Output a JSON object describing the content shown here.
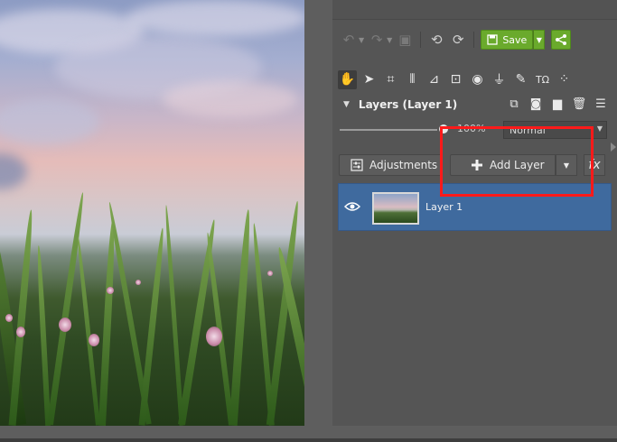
{
  "canvas": {
    "image_subject": "sunset sky over meadow grass with clover flowers"
  },
  "toolbar": {
    "undo_icon": "undo-icon",
    "redo_icon": "redo-icon",
    "history_icon": "history-icon",
    "rotate_left_icon": "rotate-left-icon",
    "rotate_right_icon": "rotate-right-icon",
    "save_label": "Save",
    "share_icon": "share-icon"
  },
  "tools": [
    {
      "name": "hand-tool-icon",
      "glyph": "✋",
      "active": true
    },
    {
      "name": "select-tool-icon",
      "glyph": "➤",
      "active": false
    },
    {
      "name": "crop-tool-icon",
      "glyph": "⌗",
      "active": false
    },
    {
      "name": "perspective-tool-icon",
      "glyph": "⦀",
      "active": false
    },
    {
      "name": "straighten-tool-icon",
      "glyph": "⊿",
      "active": false
    },
    {
      "name": "frame-tool-icon",
      "glyph": "⊡",
      "active": false
    },
    {
      "name": "eye-tool-icon",
      "glyph": "◉",
      "active": false
    },
    {
      "name": "stamp-tool-icon",
      "glyph": "⏚",
      "active": false
    },
    {
      "name": "brush-tool-icon",
      "glyph": "✎",
      "active": false
    },
    {
      "name": "text-tool-icon",
      "glyph": "TΩ",
      "active": false
    },
    {
      "name": "effects-tool-icon",
      "glyph": "⁘",
      "active": false
    }
  ],
  "layers_panel": {
    "title": "Layers (Layer 1)",
    "opacity": "100%",
    "blend_mode": "Normal",
    "adjustments_label": "Adjustments",
    "add_layer_label": "Add Layer",
    "fx_label": "fx",
    "layers": [
      {
        "name": "Layer 1",
        "visible": true,
        "selected": true
      }
    ]
  },
  "colors": {
    "accent_green": "#6aaa2c",
    "selection_blue": "#3f6a9e",
    "highlight_red": "#ff1a1a"
  }
}
